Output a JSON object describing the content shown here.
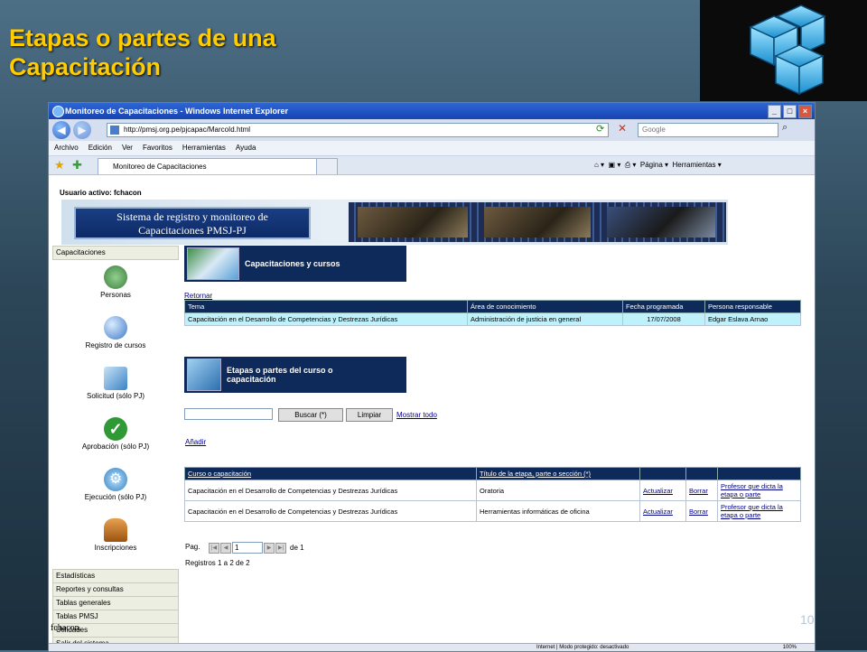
{
  "slide": {
    "title_line1": "Etapas  o partes de una",
    "title_line2": "Capacitación",
    "page_number": "10"
  },
  "browser": {
    "title": "Monitoreo de Capacitaciones - Windows Internet Explorer",
    "url": "http://pmsj.org.pe/pjcapac/MarcoId.html",
    "search_placeholder": "Google",
    "menu": [
      "Archivo",
      "Edición",
      "Ver",
      "Favoritos",
      "Herramientas",
      "Ayuda"
    ],
    "tab_title": "Monitoreo de Capacitaciones",
    "tools": {
      "page": "Página",
      "tools": "Herramientas"
    },
    "status": "Internet | Modo protegido: desactivado",
    "zoom": "100%"
  },
  "app": {
    "user_label": "Usuario activo: fchacon",
    "banner_line1": "Sistema de registro y monitoreo de",
    "banner_line2": "Capacitaciones PMSJ-PJ",
    "sidebar_header": "Capacitaciones",
    "sidebar_items": [
      {
        "label": "Personas",
        "icon": "people-icon",
        "color": "#5aa05a"
      },
      {
        "label": "Registro de cursos",
        "icon": "globe-icon",
        "color": "#5d8fd6"
      },
      {
        "label": "Solicitud (sólo PJ)",
        "icon": "book-icon",
        "color": "#4a8cc9"
      },
      {
        "label": "Aprobación (sólo PJ)",
        "icon": "checkmark-icon",
        "color": "#2f9a35"
      },
      {
        "label": "Ejecución (sólo PJ)",
        "icon": "gears-icon",
        "color": "#4f9ed9"
      },
      {
        "label": "Inscripciones",
        "icon": "person-icon",
        "color": "#c57b26"
      }
    ],
    "sidebar_links": [
      "Estadísticas",
      "Reportes y consultas",
      "Tablas generales",
      "Tablas PMSJ",
      "Utilidades",
      "Salir del sistema"
    ],
    "footer_user": "fchacon.",
    "section1_title": "Capacitaciones y cursos",
    "back_link": "Retornar",
    "course_table": {
      "headers": [
        "Tema",
        "Área de conocimiento",
        "Fecha programada",
        "Persona responsable"
      ],
      "row": [
        "Capacitación en el Desarrollo de Competencias y Destrezas Jurídicas",
        "Administración de justicia en general",
        "17/07/2008",
        "Edgar Eslava Arnao"
      ]
    },
    "section2_title": "Etapas o partes del curso o capacitación",
    "search_button": "Buscar (*)",
    "clear_button": "Limpiar",
    "show_all": "Mostrar todo",
    "add_link": "Añadir",
    "stages_table": {
      "headers": [
        "Curso o capacitación",
        "Título de la etapa, parte o sección (*)"
      ],
      "rows": [
        {
          "course": "Capacitación en el Desarrollo de Competencias y Destrezas Jurídicas",
          "stage": "Oratoria",
          "update": "Actualizar",
          "delete": "Borrar",
          "teacher": "Profesor que dicta la etapa o parte"
        },
        {
          "course": "Capacitación en el Desarrollo de Competencias y Destrezas Jurídicas",
          "stage": "Herramientas informáticas de oficina",
          "update": "Actualizar",
          "delete": "Borrar",
          "teacher": "Profesor que dicta la etapa o parte"
        }
      ]
    },
    "pager": {
      "label": "Pag.",
      "current": "1",
      "of": "de 1"
    },
    "records": "Registros 1 a 2 de 2"
  }
}
